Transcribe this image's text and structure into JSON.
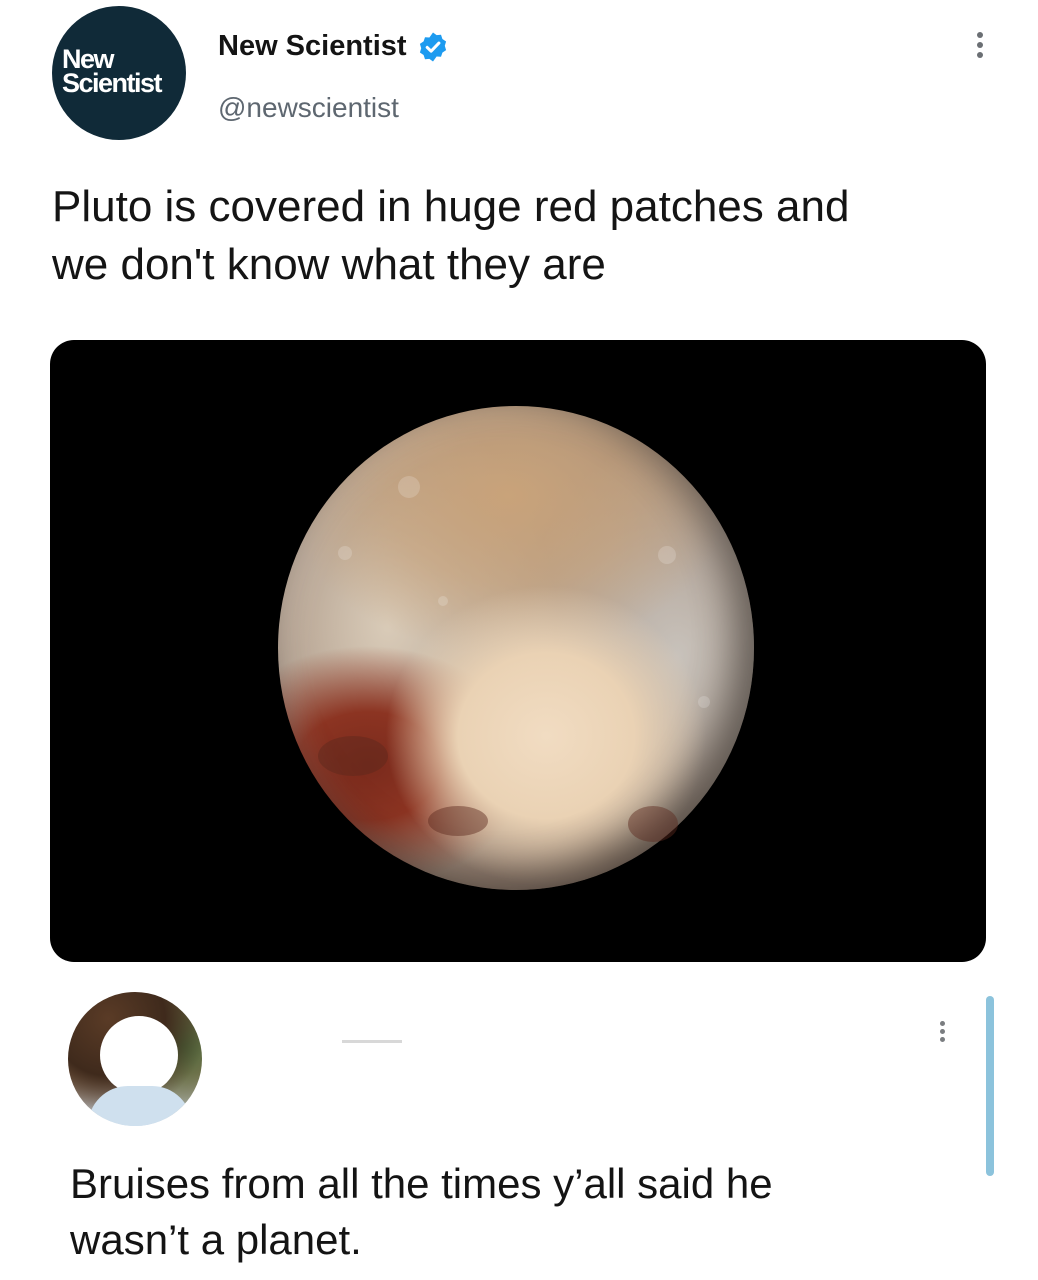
{
  "tweet": {
    "avatar": {
      "logo_line1": "New",
      "logo_line2": "Scientist",
      "background_color": "#102a38"
    },
    "display_name": "New Scientist",
    "verified": true,
    "verified_icon": "verified-badge-icon",
    "handle": "@newscientist",
    "more_icon": "more-vertical-icon",
    "text_line1": "Pluto is covered in huge red patches and",
    "text_line2": "we don't know what they are",
    "media": {
      "subject": "pluto-photo",
      "background_color": "#000000"
    }
  },
  "reply": {
    "avatar": "user-avatar-obscured",
    "more_icon": "more-vertical-icon",
    "text_line1": "Bruises from all the times y’all said he",
    "text_line2": "wasn’t a planet.",
    "accent_color": "#8cc3dc"
  }
}
